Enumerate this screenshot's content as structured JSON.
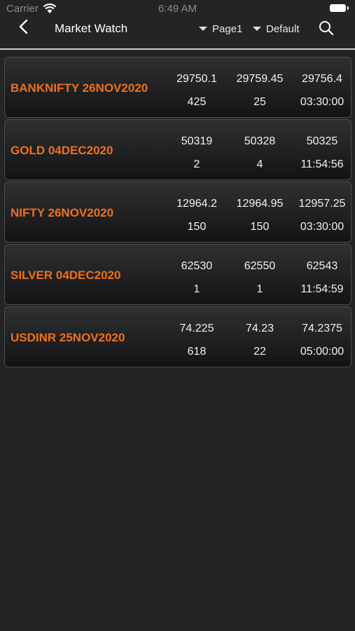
{
  "status_bar": {
    "carrier": "Carrier",
    "time": "6:49 AM"
  },
  "header": {
    "title": "Market Watch",
    "page_selector": "Page1",
    "profile_selector": "Default",
    "back_icon": "chevron-left-icon",
    "search_icon": "search-icon"
  },
  "colors": {
    "background": "#222426",
    "symbol": "#f0701e",
    "text": "#ffffff"
  },
  "watchlist": [
    {
      "symbol": "BANKNIFTY 26NOV2020",
      "bid": "29750.1",
      "ask": "29759.45",
      "ltp": "29756.4",
      "bid_qty": "425",
      "ask_qty": "25",
      "time": "03:30:00"
    },
    {
      "symbol": "GOLD 04DEC2020",
      "bid": "50319",
      "ask": "50328",
      "ltp": "50325",
      "bid_qty": "2",
      "ask_qty": "4",
      "time": "11:54:56"
    },
    {
      "symbol": "NIFTY 26NOV2020",
      "bid": "12964.2",
      "ask": "12964.95",
      "ltp": "12957.25",
      "bid_qty": "150",
      "ask_qty": "150",
      "time": "03:30:00"
    },
    {
      "symbol": "SILVER 04DEC2020",
      "bid": "62530",
      "ask": "62550",
      "ltp": "62543",
      "bid_qty": "1",
      "ask_qty": "1",
      "time": "11:54:59"
    },
    {
      "symbol": "USDINR 25NOV2020",
      "bid": "74.225",
      "ask": "74.23",
      "ltp": "74.2375",
      "bid_qty": "618",
      "ask_qty": "22",
      "time": "05:00:00"
    }
  ]
}
